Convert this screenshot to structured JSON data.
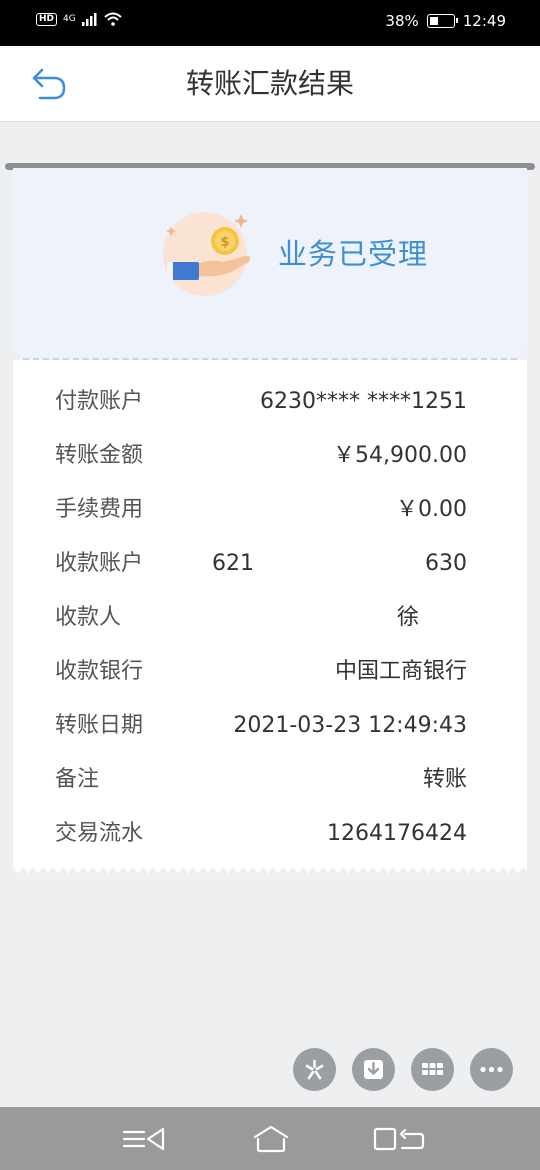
{
  "status_bar": {
    "hd": "HD",
    "network": "4G",
    "battery": "38%",
    "time": "12:49",
    "battery_level": 0.38
  },
  "header": {
    "title": "转账汇款结果",
    "back_icon": "back-arrow-icon"
  },
  "result": {
    "status": "业务已受理",
    "illustration_icon": "coin-hand-icon",
    "accent_color": "#3b8ed8"
  },
  "details": {
    "payer_account": {
      "label": "付款账户",
      "value": "6230**** ****1251"
    },
    "amount": {
      "label": "转账金额",
      "value": "￥54,900.00"
    },
    "fee": {
      "label": "手续费用",
      "value": "￥0.00"
    },
    "payee_account": {
      "label": "收款账户",
      "value_start": "621",
      "value_end": "630"
    },
    "payee": {
      "label": "收款人",
      "value": "徐"
    },
    "bank": {
      "label": "收款银行",
      "value": "中国工商银行"
    },
    "date": {
      "label": "转账日期",
      "value": "2021-03-23 12:49:43"
    },
    "note": {
      "label": "备注",
      "value": "转账"
    },
    "serial": {
      "label": "交易流水",
      "value": "1264176424"
    }
  },
  "actions": [
    {
      "icon": "share-icon"
    },
    {
      "icon": "download-icon"
    },
    {
      "icon": "grid-icon"
    },
    {
      "icon": "more-icon"
    }
  ],
  "nav_bar": {
    "menu_icon": "menu-back-icon",
    "home_icon": "home-icon",
    "recent_icon": "recent-apps-icon"
  }
}
